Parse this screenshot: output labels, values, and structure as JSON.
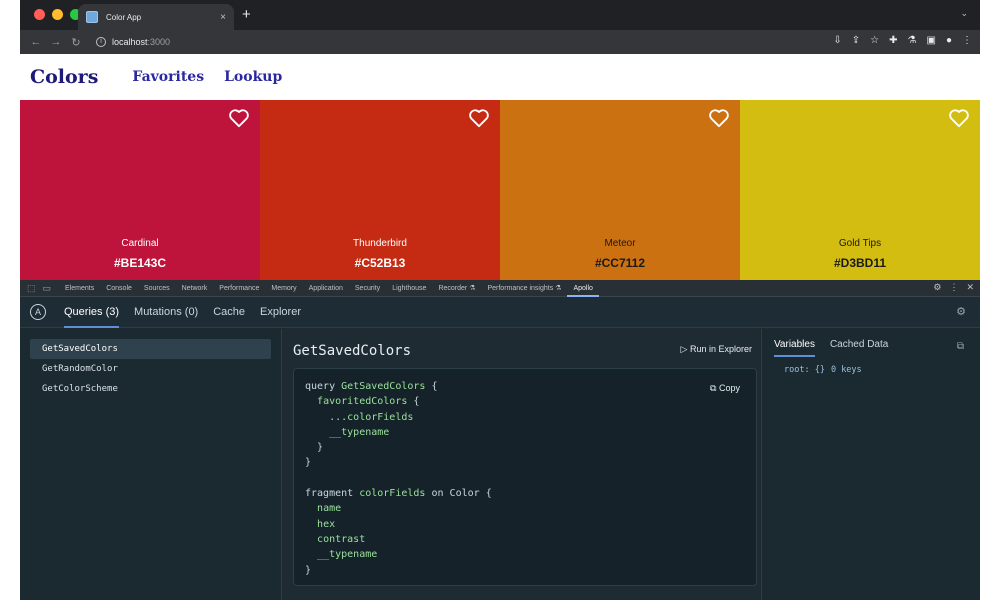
{
  "browser": {
    "tab_title": "Color App",
    "tab_close": "×",
    "new_tab": "+",
    "url_host": "localhost",
    "url_port": ":3000"
  },
  "app": {
    "brand": "Colors",
    "nav": [
      "Favorites",
      "Lookup"
    ]
  },
  "colors": [
    {
      "name": "Cardinal",
      "hex": "#BE143C",
      "text_color": "#ffffff"
    },
    {
      "name": "Thunderbird",
      "hex": "#C52B13",
      "text_color": "#ffffff"
    },
    {
      "name": "Meteor",
      "hex": "#CC7112",
      "text_color": "#1a1a1a"
    },
    {
      "name": "Gold Tips",
      "hex": "#D3BD11",
      "text_color": "#1a1a1a"
    }
  ],
  "devtools": {
    "tabs": [
      "Elements",
      "Console",
      "Sources",
      "Network",
      "Performance",
      "Memory",
      "Application",
      "Security",
      "Lighthouse",
      "Recorder ⚗",
      "Performance insights ⚗",
      "Apollo"
    ],
    "active_tab": "Apollo"
  },
  "apollo": {
    "logo": "A",
    "tabs": [
      "Queries (3)",
      "Mutations (0)",
      "Cache",
      "Explorer"
    ],
    "queries": [
      "GetSavedColors",
      "GetRandomColor",
      "GetColorScheme"
    ],
    "selected_query": "GetSavedColors",
    "query_title": "GetSavedColors",
    "run_label": "Run in Explorer",
    "copy_label": "Copy",
    "code_lines": [
      "query GetSavedColors {",
      "  favoritedColors {",
      "    ...colorFields",
      "    __typename",
      "  }",
      "}",
      "",
      "fragment colorFields on Color {",
      "  name",
      "  hex",
      "  contrast",
      "  __typename",
      "}"
    ],
    "right_tabs": [
      "Variables",
      "Cached Data"
    ],
    "variables_key": "root: {}",
    "variables_count": "0 keys"
  },
  "icons": [
    "info-icon",
    "heart-icon",
    "copy-icon",
    "gear-icon",
    "play-icon"
  ]
}
